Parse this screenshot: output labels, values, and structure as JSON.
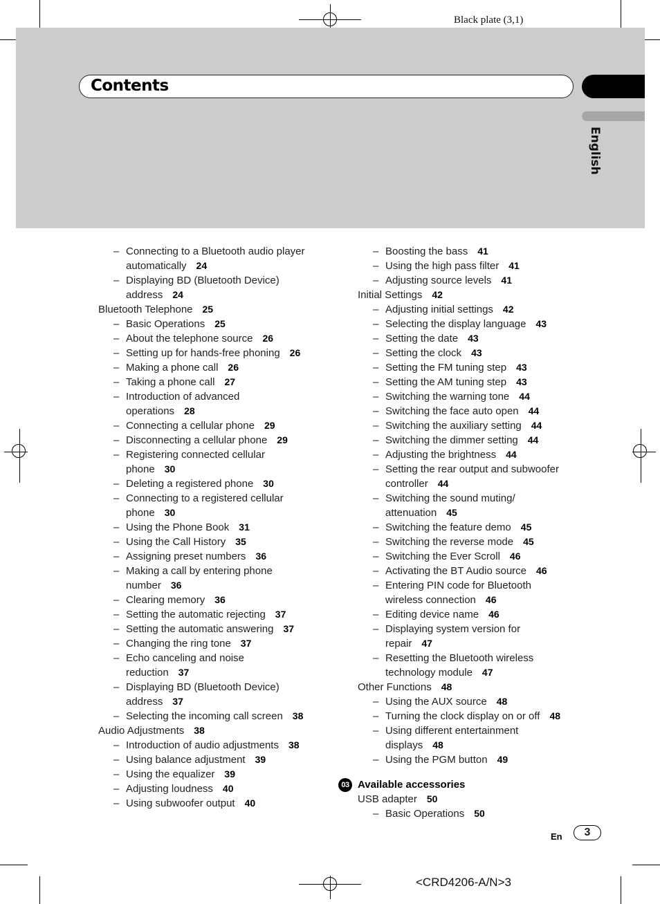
{
  "print_marks": {
    "plate_label": "Black plate (3,1)",
    "doc_code": "<CRD4206-A/N>3"
  },
  "header": {
    "title": "Contents",
    "language_tab": "English"
  },
  "left_column": [
    {
      "level": 2,
      "text": "Connecting to a Bluetooth audio player automatically",
      "lines": [
        "Connecting to a Bluetooth audio player",
        "automatically"
      ],
      "page": "24"
    },
    {
      "level": 2,
      "text": "Displaying BD (Bluetooth Device) address",
      "lines": [
        "Displaying BD (Bluetooth Device)",
        "address"
      ],
      "page": "24"
    },
    {
      "level": 1,
      "lines": [
        "Bluetooth Telephone"
      ],
      "page": "25"
    },
    {
      "level": 2,
      "lines": [
        "Basic Operations"
      ],
      "page": "25"
    },
    {
      "level": 2,
      "lines": [
        "About the telephone source"
      ],
      "page": "26"
    },
    {
      "level": 2,
      "lines": [
        "Setting up for hands-free phoning"
      ],
      "page": "26"
    },
    {
      "level": 2,
      "lines": [
        "Making a phone call"
      ],
      "page": "26"
    },
    {
      "level": 2,
      "lines": [
        "Taking a phone call"
      ],
      "page": "27"
    },
    {
      "level": 2,
      "lines": [
        "Introduction of advanced",
        "operations"
      ],
      "page": "28"
    },
    {
      "level": 2,
      "lines": [
        "Connecting a cellular phone"
      ],
      "page": "29"
    },
    {
      "level": 2,
      "lines": [
        "Disconnecting a cellular phone"
      ],
      "page": "29"
    },
    {
      "level": 2,
      "lines": [
        "Registering connected cellular",
        "phone"
      ],
      "page": "30"
    },
    {
      "level": 2,
      "lines": [
        "Deleting a registered phone"
      ],
      "page": "30"
    },
    {
      "level": 2,
      "lines": [
        "Connecting to a registered cellular",
        "phone"
      ],
      "page": "30"
    },
    {
      "level": 2,
      "lines": [
        "Using the Phone Book"
      ],
      "page": "31"
    },
    {
      "level": 2,
      "lines": [
        "Using the Call History"
      ],
      "page": "35"
    },
    {
      "level": 2,
      "lines": [
        "Assigning preset numbers"
      ],
      "page": "36"
    },
    {
      "level": 2,
      "lines": [
        "Making a call by entering phone",
        "number"
      ],
      "page": "36"
    },
    {
      "level": 2,
      "lines": [
        "Clearing memory"
      ],
      "page": "36"
    },
    {
      "level": 2,
      "lines": [
        "Setting the automatic rejecting"
      ],
      "page": "37"
    },
    {
      "level": 2,
      "lines": [
        "Setting the automatic answering"
      ],
      "page": "37"
    },
    {
      "level": 2,
      "lines": [
        "Changing the ring tone"
      ],
      "page": "37"
    },
    {
      "level": 2,
      "lines": [
        "Echo canceling and noise",
        "reduction"
      ],
      "page": "37"
    },
    {
      "level": 2,
      "lines": [
        "Displaying BD (Bluetooth Device)",
        "address"
      ],
      "page": "37"
    },
    {
      "level": 2,
      "lines": [
        "Selecting the incoming call screen"
      ],
      "page": "38"
    },
    {
      "level": 1,
      "lines": [
        "Audio Adjustments"
      ],
      "page": "38"
    },
    {
      "level": 2,
      "lines": [
        "Introduction of audio adjustments"
      ],
      "page": "38"
    },
    {
      "level": 2,
      "lines": [
        "Using balance adjustment"
      ],
      "page": "39"
    },
    {
      "level": 2,
      "lines": [
        "Using the equalizer"
      ],
      "page": "39"
    },
    {
      "level": 2,
      "lines": [
        "Adjusting loudness"
      ],
      "page": "40"
    },
    {
      "level": 2,
      "lines": [
        "Using subwoofer output"
      ],
      "page": "40"
    }
  ],
  "right_column": [
    {
      "level": 2,
      "lines": [
        "Boosting the bass"
      ],
      "page": "41"
    },
    {
      "level": 2,
      "lines": [
        "Using the high pass filter"
      ],
      "page": "41"
    },
    {
      "level": 2,
      "lines": [
        "Adjusting source levels"
      ],
      "page": "41"
    },
    {
      "level": 1,
      "lines": [
        "Initial Settings"
      ],
      "page": "42"
    },
    {
      "level": 2,
      "lines": [
        "Adjusting initial settings"
      ],
      "page": "42"
    },
    {
      "level": 2,
      "lines": [
        "Selecting the display language"
      ],
      "page": "43"
    },
    {
      "level": 2,
      "lines": [
        "Setting the date"
      ],
      "page": "43"
    },
    {
      "level": 2,
      "lines": [
        "Setting the clock"
      ],
      "page": "43"
    },
    {
      "level": 2,
      "lines": [
        "Setting the FM tuning step"
      ],
      "page": "43"
    },
    {
      "level": 2,
      "lines": [
        "Setting the AM tuning step"
      ],
      "page": "43"
    },
    {
      "level": 2,
      "lines": [
        "Switching the warning tone"
      ],
      "page": "44"
    },
    {
      "level": 2,
      "lines": [
        "Switching the face auto open"
      ],
      "page": "44"
    },
    {
      "level": 2,
      "lines": [
        "Switching the auxiliary setting"
      ],
      "page": "44"
    },
    {
      "level": 2,
      "lines": [
        "Switching the dimmer setting"
      ],
      "page": "44"
    },
    {
      "level": 2,
      "lines": [
        "Adjusting the brightness"
      ],
      "page": "44"
    },
    {
      "level": 2,
      "lines": [
        "Setting the rear output and subwoofer",
        "controller"
      ],
      "page": "44"
    },
    {
      "level": 2,
      "lines": [
        "Switching the sound muting/",
        "attenuation"
      ],
      "page": "45"
    },
    {
      "level": 2,
      "lines": [
        "Switching the feature demo"
      ],
      "page": "45"
    },
    {
      "level": 2,
      "lines": [
        "Switching the reverse mode"
      ],
      "page": "45"
    },
    {
      "level": 2,
      "lines": [
        "Switching the Ever Scroll"
      ],
      "page": "46"
    },
    {
      "level": 2,
      "lines": [
        "Activating the BT Audio source"
      ],
      "page": "46"
    },
    {
      "level": 2,
      "lines": [
        "Entering PIN code for Bluetooth",
        "wireless connection"
      ],
      "page": "46"
    },
    {
      "level": 2,
      "lines": [
        "Editing device name"
      ],
      "page": "46"
    },
    {
      "level": 2,
      "lines": [
        "Displaying system version for",
        "repair"
      ],
      "page": "47"
    },
    {
      "level": 2,
      "lines": [
        "Resetting the Bluetooth wireless",
        "technology module"
      ],
      "page": "47"
    },
    {
      "level": 1,
      "lines": [
        "Other Functions"
      ],
      "page": "48"
    },
    {
      "level": 2,
      "lines": [
        "Using the AUX source"
      ],
      "page": "48"
    },
    {
      "level": 2,
      "lines": [
        "Turning the clock display on or off"
      ],
      "page": "48"
    },
    {
      "level": 2,
      "lines": [
        "Using different entertainment",
        "displays"
      ],
      "page": "48"
    },
    {
      "level": 2,
      "lines": [
        "Using the PGM button"
      ],
      "page": "49"
    }
  ],
  "section_03": {
    "badge": "03",
    "title": "Available accessories",
    "entries": [
      {
        "level": 1,
        "lines": [
          "USB adapter"
        ],
        "page": "50"
      },
      {
        "level": 2,
        "lines": [
          "Basic Operations"
        ],
        "page": "50"
      }
    ]
  },
  "footer": {
    "lang_code": "En",
    "page_number": "3"
  },
  "dash_glyph": "–"
}
